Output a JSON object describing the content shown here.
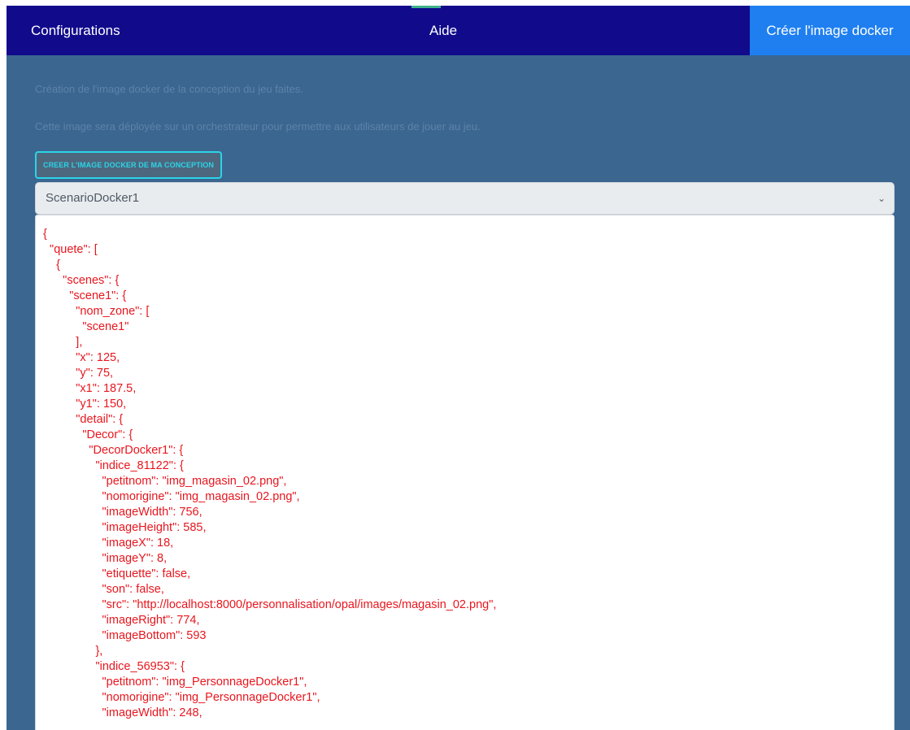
{
  "nav": {
    "configurations": "Configurations",
    "aide": "Aide",
    "create_docker_image": "Créer l'image docker"
  },
  "content": {
    "description_line1": "Création de l'image docker de la conception du jeu faites.",
    "description_line2": "Cette image sera déployée sur un orchestrateur pour permettre aux utilisateurs de jouer au jeu.",
    "create_button_label": "CREER L'IMAGE DOCKER DE MA CONCEPTION",
    "select_value": "ScenarioDocker1",
    "json_text": "{\n  \"quete\": [\n    {\n      \"scenes\": {\n        \"scene1\": {\n          \"nom_zone\": [\n            \"scene1\"\n          ],\n          \"x\": 125,\n          \"y\": 75,\n          \"x1\": 187.5,\n          \"y1\": 150,\n          \"detail\": {\n            \"Decor\": {\n              \"DecorDocker1\": {\n                \"indice_81122\": {\n                  \"petitnom\": \"img_magasin_02.png\",\n                  \"nomorigine\": \"img_magasin_02.png\",\n                  \"imageWidth\": 756,\n                  \"imageHeight\": 585,\n                  \"imageX\": 18,\n                  \"imageY\": 8,\n                  \"etiquette\": false,\n                  \"son\": false,\n                  \"src\": \"http://localhost:8000/personnalisation/opal/images/magasin_02.png\",\n                  \"imageRight\": 774,\n                  \"imageBottom\": 593\n                },\n                \"indice_56953\": {\n                  \"petitnom\": \"img_PersonnageDocker1\",\n                  \"nomorigine\": \"img_PersonnageDocker1\",\n                  \"imageWidth\": 248,"
  },
  "colors": {
    "nav_background": "#110b8c",
    "active_nav_button": "#1f7ff0",
    "page_background": "#3b6690",
    "json_text": "#e8161e",
    "button_accent": "#2ad4e6"
  },
  "icons": {
    "select_arrow": "chevron-down-icon"
  }
}
